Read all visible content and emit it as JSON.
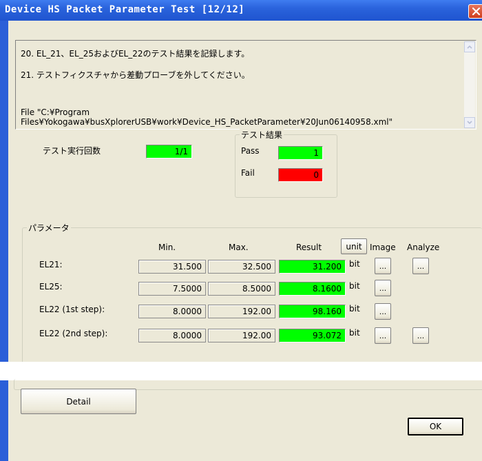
{
  "window": {
    "title": "Device HS Packet Parameter Test [12/12]"
  },
  "messages": {
    "line1": "20. EL_21、EL_25およびEL_22のテスト結果を記録します。",
    "line2": "21. テストフィクスチャから差動プローブを外してください。",
    "line3": "File \"C:¥Program\nFiles¥Yokogawa¥busXplorerUSB¥work¥Device_HS_PacketParameter¥20Jun06140958.xml\""
  },
  "run_count": {
    "label": "テスト実行回数",
    "value": "1/1"
  },
  "test_result": {
    "title": "テスト結果",
    "pass_label": "Pass",
    "pass_value": "1",
    "fail_label": "Fail",
    "fail_value": "0"
  },
  "parameters": {
    "title": "パラメータ",
    "headers": {
      "min": "Min.",
      "max": "Max.",
      "result": "Result",
      "unit": "unit",
      "image": "Image",
      "analyze": "Analyze"
    },
    "rows": [
      {
        "name": "EL21:",
        "min": "31.500",
        "max": "32.500",
        "result": "31.200",
        "unit": "bit"
      },
      {
        "name": "EL25:",
        "min": "7.5000",
        "max": "8.5000",
        "result": "8.1600",
        "unit": "bit"
      },
      {
        "name": "EL22 (1st step):",
        "min": "8.0000",
        "max": "192.00",
        "result": "98.160",
        "unit": "bit"
      },
      {
        "name": "EL22 (2nd step):",
        "min": "8.0000",
        "max": "192.00",
        "result": "93.072",
        "unit": "bit"
      }
    ],
    "button_label": "..."
  },
  "buttons": {
    "detail": "Detail",
    "ok": "OK"
  },
  "colors": {
    "pass": "#00ff00",
    "fail": "#ff0000",
    "titlebar": "#2a63dc",
    "face": "#ece9d8"
  }
}
